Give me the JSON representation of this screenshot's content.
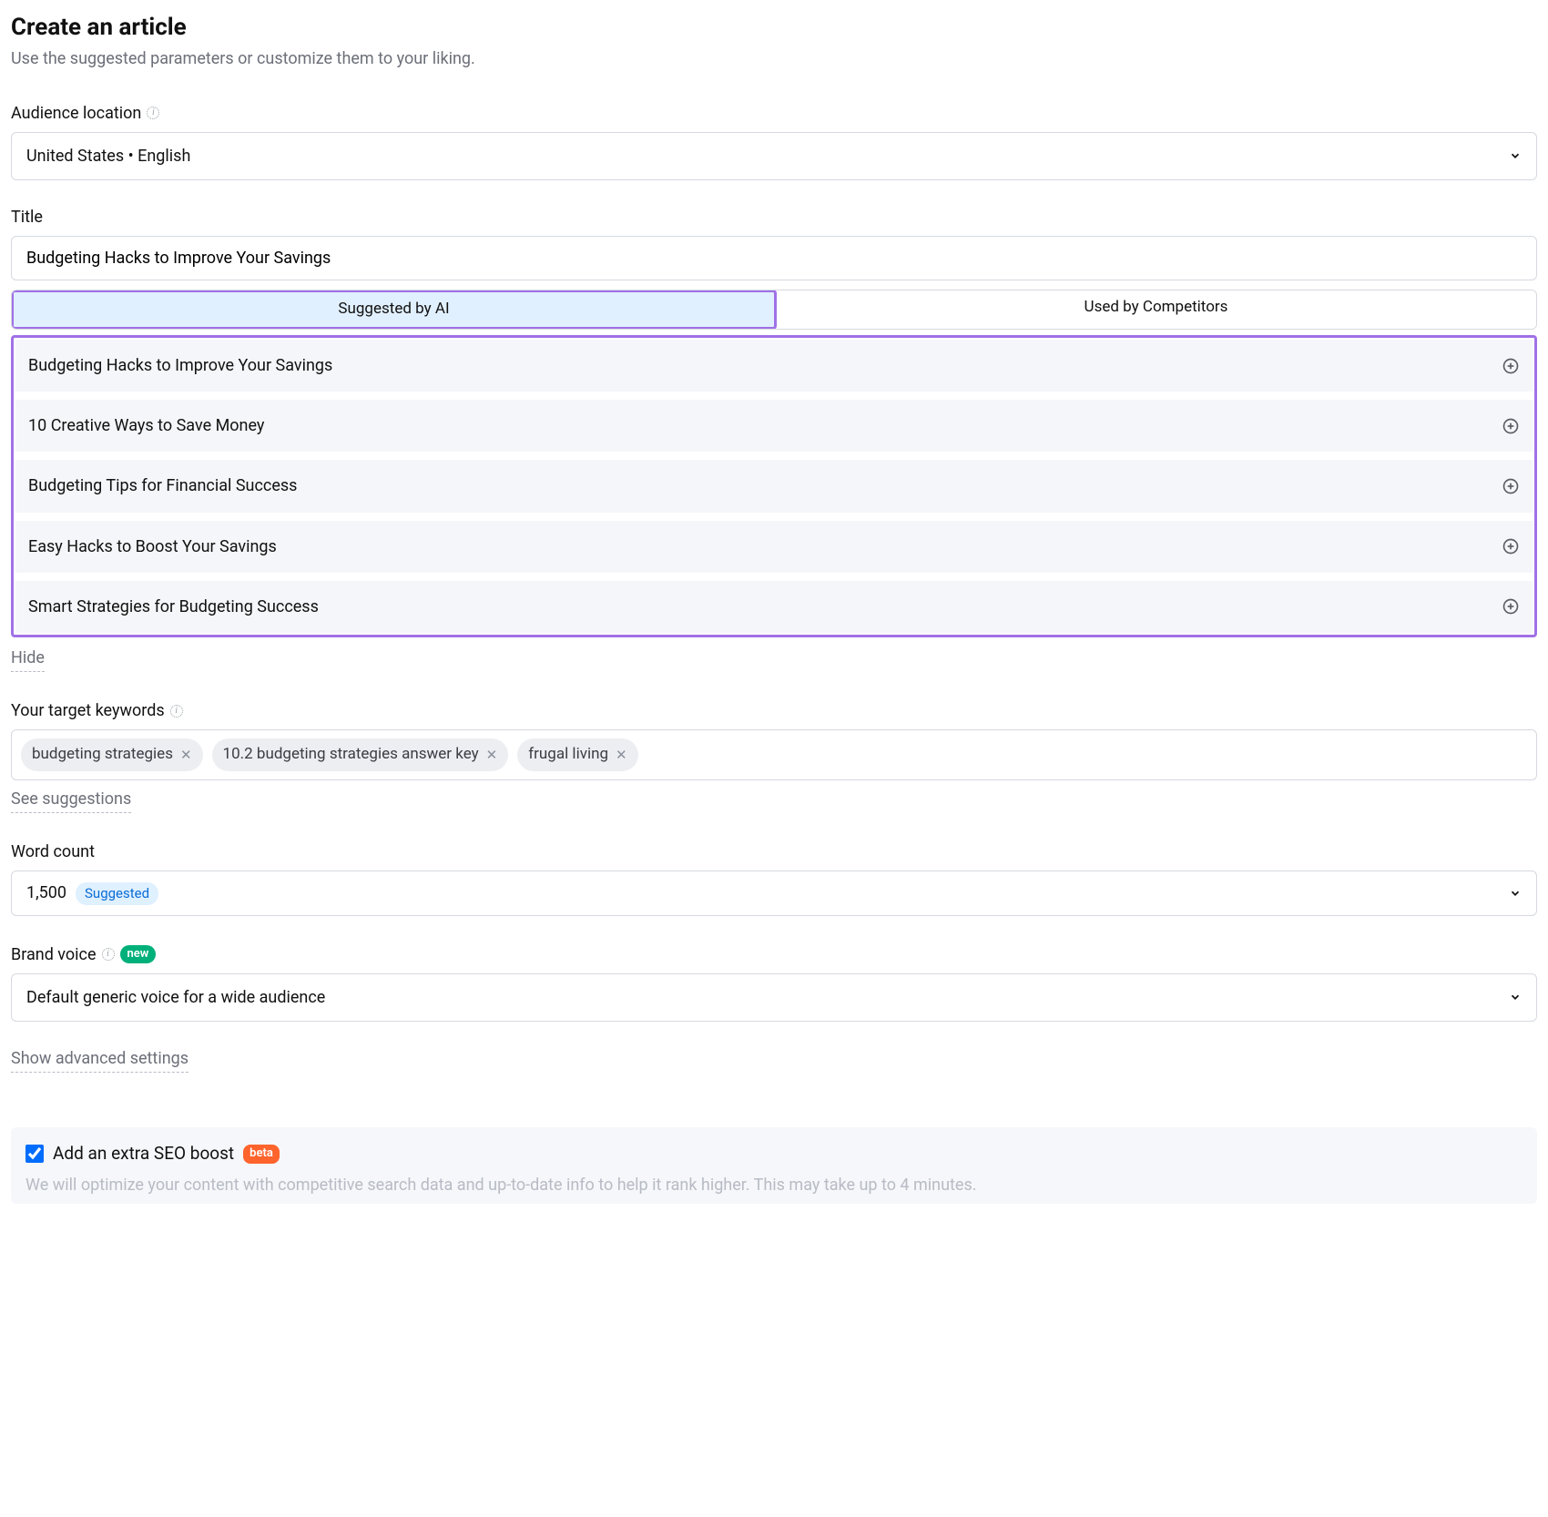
{
  "header": {
    "title": "Create an article",
    "subtitle": "Use the suggested parameters or customize them to your liking."
  },
  "audience": {
    "label": "Audience location",
    "value": "United States • English"
  },
  "title_field": {
    "label": "Title",
    "value": "Budgeting Hacks to Improve Your Savings"
  },
  "tabs": {
    "ai": "Suggested by AI",
    "competitors": "Used by Competitors"
  },
  "suggestions": [
    "Budgeting Hacks to Improve Your Savings",
    "10 Creative Ways to Save Money",
    "Budgeting Tips for Financial Success",
    "Easy Hacks to Boost Your Savings",
    "Smart Strategies for Budgeting Success"
  ],
  "hide_label": "Hide",
  "keywords": {
    "label": "Your target keywords",
    "chips": [
      "budgeting strategies",
      "10.2 budgeting strategies answer key",
      "frugal living"
    ],
    "see": "See suggestions"
  },
  "wordcount": {
    "label": "Word count",
    "value": "1,500",
    "badge": "Suggested"
  },
  "brandvoice": {
    "label": "Brand voice",
    "new_badge": "new",
    "value": "Default generic voice for a wide audience"
  },
  "advanced_label": "Show advanced settings",
  "seo": {
    "title": "Add an extra SEO boost",
    "beta": "beta",
    "desc": "We will optimize your content with competitive search data and up-to-date info to help it rank higher. This may take up to 4 minutes."
  }
}
